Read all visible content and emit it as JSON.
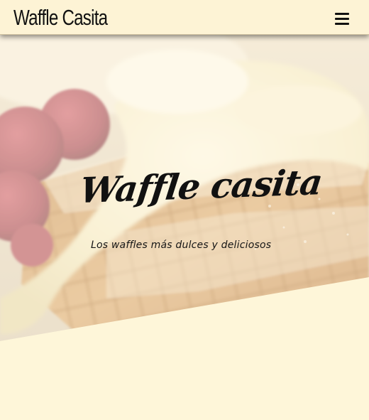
{
  "header": {
    "brand": "Waffle Casita",
    "menu_icon": "hamburger-menu-icon"
  },
  "hero": {
    "title": "Waffle casita",
    "subtitle": "Los waffles más dulces y deliciosos",
    "background_image": "waffle-with-cream-and-raspberries"
  },
  "colors": {
    "page_background": "#fef6d9",
    "header_background": "#fdf3d5",
    "text": "#111111"
  }
}
